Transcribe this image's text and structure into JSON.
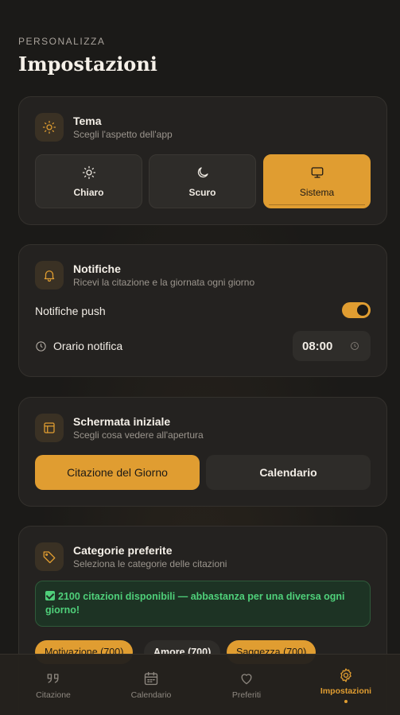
{
  "header": {
    "eyebrow": "PERSONALIZZA",
    "title": "Impostazioni"
  },
  "theme": {
    "title": "Tema",
    "subtitle": "Scegli l'aspetto dell'app",
    "options": [
      {
        "label": "Chiaro",
        "icon": "sun-icon"
      },
      {
        "label": "Scuro",
        "icon": "moon-icon"
      },
      {
        "label": "Sistema",
        "icon": "monitor-icon"
      }
    ],
    "selected": "Sistema"
  },
  "notifications": {
    "title": "Notifiche",
    "subtitle": "Ricevi la citazione e la giornata ogni giorno",
    "push_label": "Notifiche push",
    "push_enabled": true,
    "time_label": "Orario notifica",
    "time_value": "08:00"
  },
  "home_screen": {
    "title": "Schermata iniziale",
    "subtitle": "Scegli cosa vedere all'apertura",
    "options": [
      "Citazione del Giorno",
      "Calendario"
    ],
    "selected": "Citazione del Giorno"
  },
  "categories": {
    "title": "Categorie preferite",
    "subtitle": "Seleziona le categorie delle citazioni",
    "notice": "2100 citazioni disponibili — abbastanza per una diversa ogni giorno!",
    "chips": [
      {
        "label": "Motivazione (700)",
        "selected": true
      },
      {
        "label": "Amore (700)",
        "selected": false
      },
      {
        "label": "Saggezza (700)",
        "selected": true
      }
    ]
  },
  "nav": {
    "items": [
      {
        "label": "Citazione",
        "icon": "quote-icon"
      },
      {
        "label": "Calendario",
        "icon": "calendar-icon"
      },
      {
        "label": "Preferiti",
        "icon": "heart-icon"
      },
      {
        "label": "Impostazioni",
        "icon": "gear-icon"
      }
    ],
    "active": "Impostazioni"
  },
  "colors": {
    "accent": "#e09d31",
    "background": "#1b1a18",
    "card": "#242220",
    "success": "#4fd07a"
  }
}
